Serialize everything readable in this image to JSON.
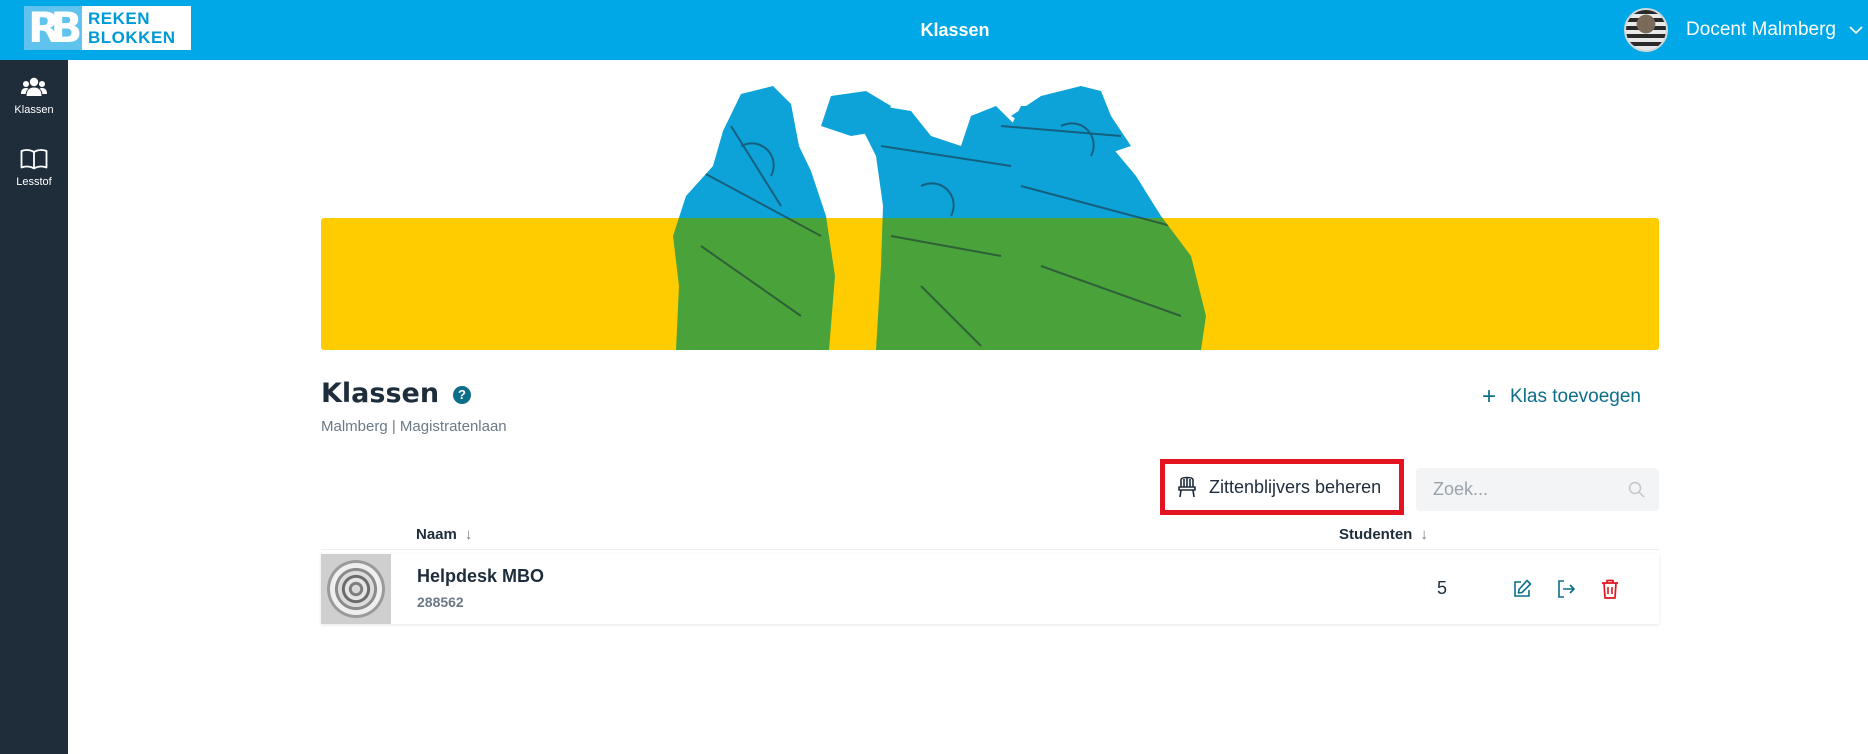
{
  "topbar": {
    "logo_text_line1": "REKEN",
    "logo_text_line2": "BLOKKEN",
    "logo_mark": "RB",
    "title": "Klassen",
    "user_name": "Docent Malmberg"
  },
  "sidebar": {
    "items": [
      {
        "label": "Klassen",
        "icon": "users-icon"
      },
      {
        "label": "Lesstof",
        "icon": "book-icon"
      }
    ]
  },
  "page": {
    "title": "Klassen",
    "help": "?",
    "subtitle": "Malmberg | Magistratenlaan",
    "add_class_label": "Klas toevoegen",
    "manage_repeaters_label": "Zittenblijvers beheren",
    "search_placeholder": "Zoek..."
  },
  "table": {
    "columns": [
      {
        "label": "Naam",
        "sort": "↓"
      },
      {
        "label": "Studenten",
        "sort": "↓"
      }
    ],
    "rows": [
      {
        "name": "Helpdesk MBO",
        "code": "288562",
        "students": "5"
      }
    ]
  },
  "colors": {
    "topbar": "#00a8e8",
    "sidebar": "#1f2d3b",
    "accent": "#0d6e8a",
    "banner_yellow": "#ffcc00",
    "highlight": "#e3141f",
    "delete": "#e3141f"
  }
}
